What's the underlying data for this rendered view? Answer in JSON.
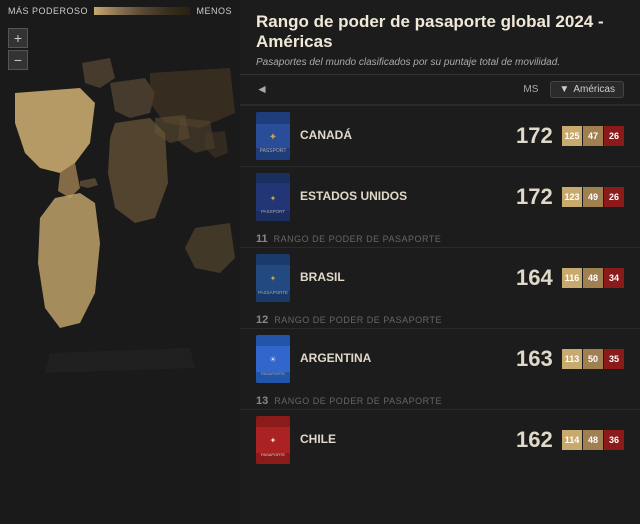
{
  "legend": {
    "more_label": "MÁS PODEROSO",
    "less_label": "MENOS"
  },
  "header": {
    "title": "Rango de poder de pasaporte global 2024 - Américas",
    "subtitle": "Pasaportes del mundo clasificados por su puntaje total de movilidad."
  },
  "toolbar": {
    "ms_label": "MS",
    "filter_label": "Américas",
    "back_label": "◄"
  },
  "rank_section_label": "RANGO DE PODER DE PASAPORTE",
  "passports": [
    {
      "rank": "",
      "country": "CANADÁ",
      "score": "172",
      "bar1": "125",
      "bar2": "47",
      "bar3": "26",
      "style": "canada"
    },
    {
      "rank": "",
      "country": "ESTADOS UNIDOS",
      "score": "172",
      "bar1": "123",
      "bar2": "49",
      "bar3": "26",
      "style": "usa"
    },
    {
      "rank": "11",
      "country": "BRASIL",
      "score": "164",
      "bar1": "116",
      "bar2": "48",
      "bar3": "34",
      "style": "brasil"
    },
    {
      "rank": "12",
      "country": "ARGENTINA",
      "score": "163",
      "bar1": "113",
      "bar2": "50",
      "bar3": "35",
      "style": "argentina"
    },
    {
      "rank": "13",
      "country": "CHILE",
      "score": "162",
      "bar1": "114",
      "bar2": "48",
      "bar3": "36",
      "style": "chile"
    }
  ]
}
